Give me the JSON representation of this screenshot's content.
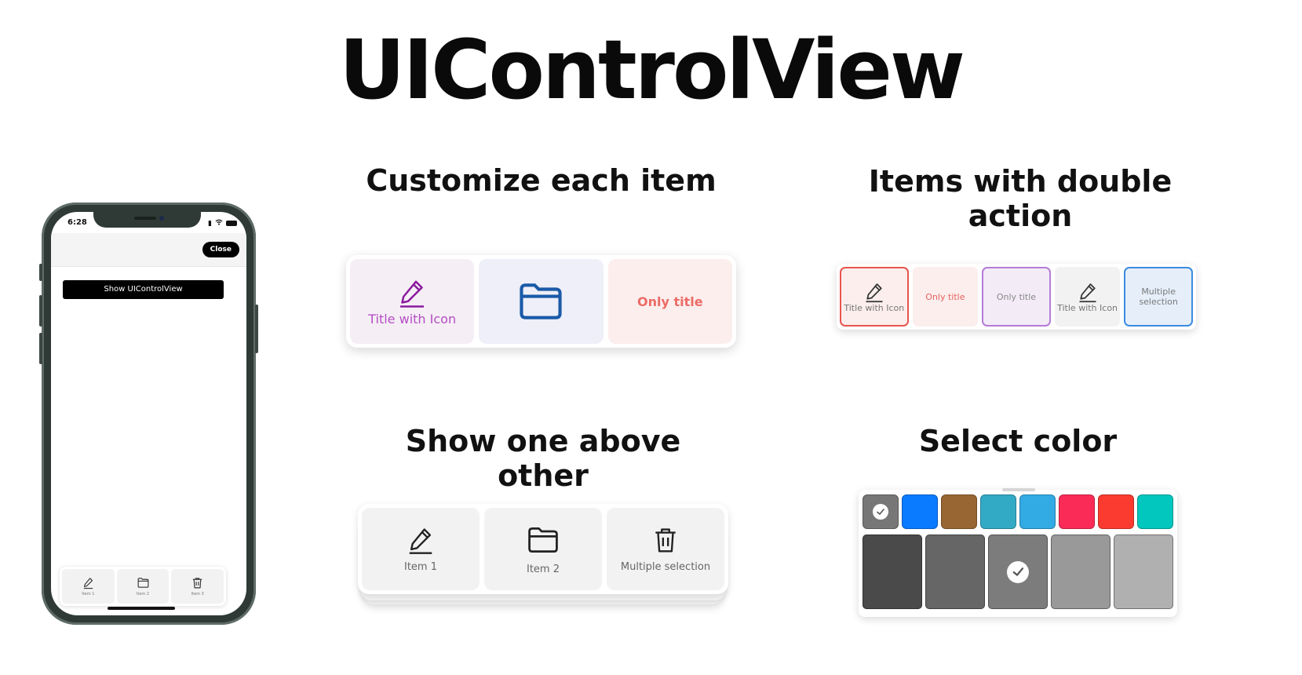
{
  "title": "UIControlView",
  "headings": {
    "customize": "Customize each item",
    "double": "Items with double action",
    "stack": "Show one above other",
    "color": "Select color"
  },
  "phone": {
    "time": "6:28",
    "close_label": "Close",
    "show_button_label": "Show UIControlView",
    "items": [
      {
        "label": "Item 1",
        "icon": "pencil-icon"
      },
      {
        "label": "Item 2",
        "icon": "folder-icon"
      },
      {
        "label": "Item 3",
        "icon": "trash-icon"
      }
    ]
  },
  "customize": {
    "items": [
      {
        "label": "Title with Icon",
        "icon": "pencil-icon",
        "bg": "#f5eef5",
        "color": "#b44ec4",
        "icon_color": "#8b1a9e"
      },
      {
        "label": "",
        "icon": "folder-icon",
        "bg": "#eeeff8",
        "icon_color": "#1a5aa8"
      },
      {
        "label": "Only title",
        "bg": "#fbeeed",
        "color": "#ec6b66"
      }
    ]
  },
  "double": {
    "items": [
      {
        "label": "Title with Icon",
        "icon": "pencil-icon",
        "bg": "#fbeeed",
        "border": "#e8544e",
        "color": "#777777"
      },
      {
        "label": "Only title",
        "bg": "#fbeeed",
        "color": "#e6625d"
      },
      {
        "label": "Only title",
        "bg": "#f3ecf7",
        "border": "#b57bd8",
        "color": "#888888"
      },
      {
        "label": "Title with Icon",
        "icon": "pencil-icon",
        "bg": "#f2f2f2",
        "color": "#777777"
      },
      {
        "label": "Multiple selection",
        "bg": "#e5eef9",
        "border": "#3b8ce0",
        "color": "#7a7a7a"
      }
    ]
  },
  "stack": {
    "items": [
      {
        "label": "Item 1",
        "icon": "pencil-icon"
      },
      {
        "label": "Item 2",
        "icon": "folder-icon"
      },
      {
        "label": "Multiple selection",
        "icon": "trash-icon"
      }
    ]
  },
  "colors": {
    "row": [
      "#777777",
      "#0a7aff",
      "#986632",
      "#33aac5",
      "#32aae4",
      "#fb2b57",
      "#fc3b30",
      "#01c7be"
    ],
    "selected_row_index": 0,
    "shades": [
      "#4a4a4a",
      "#666666",
      "#7c7c7c",
      "#999999",
      "#b0b0b0"
    ],
    "selected_shade_index": 2
  }
}
